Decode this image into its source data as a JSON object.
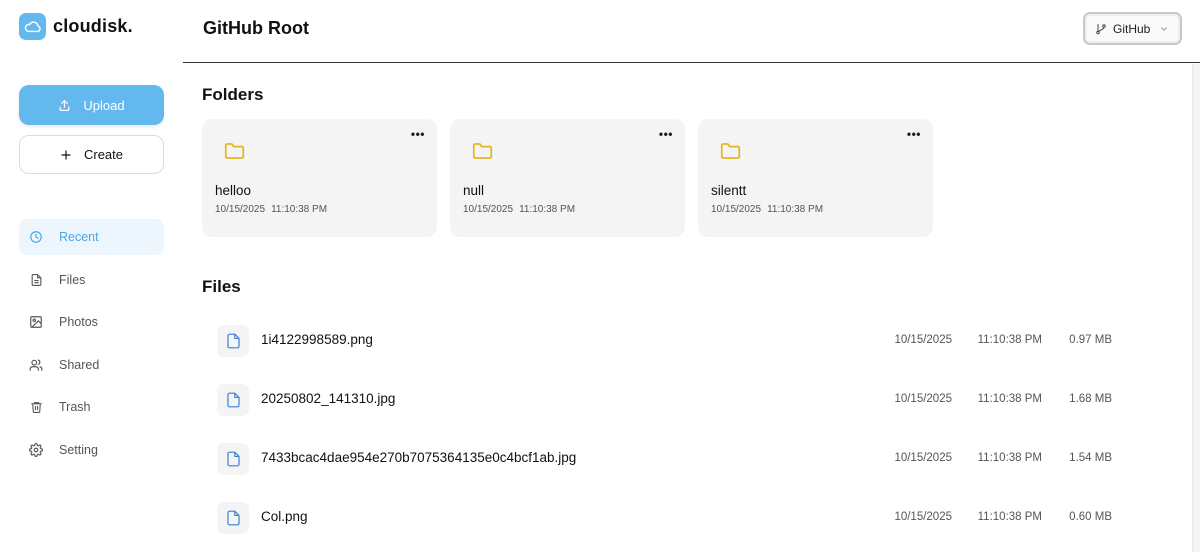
{
  "brand": {
    "name": "cloudisk."
  },
  "sidebar": {
    "upload_label": "Upload",
    "create_label": "Create",
    "items": [
      {
        "label": "Recent",
        "icon": "clock-icon"
      },
      {
        "label": "Files",
        "icon": "file-icon"
      },
      {
        "label": "Photos",
        "icon": "image-icon"
      },
      {
        "label": "Shared",
        "icon": "users-icon"
      },
      {
        "label": "Trash",
        "icon": "trash-icon"
      },
      {
        "label": "Setting",
        "icon": "gear-icon"
      }
    ],
    "active_item": "Recent"
  },
  "header": {
    "title": "GitHub Root",
    "source_select": {
      "value": "GitHub"
    }
  },
  "folders": {
    "title": "Folders",
    "items": [
      {
        "name": "helloo",
        "date": "10/15/2025",
        "time": "11:10:38 PM"
      },
      {
        "name": "null",
        "date": "10/15/2025",
        "time": "11:10:38 PM"
      },
      {
        "name": "silentt",
        "date": "10/15/2025",
        "time": "11:10:38 PM"
      }
    ]
  },
  "files": {
    "title": "Files",
    "items": [
      {
        "name": "1i4122998589.png",
        "date": "10/15/2025",
        "time": "11:10:38 PM",
        "size": "0.97 MB"
      },
      {
        "name": "20250802_141310.jpg",
        "date": "10/15/2025",
        "time": "11:10:38 PM",
        "size": "1.68 MB"
      },
      {
        "name": "7433bcac4dae954e270b7075364135e0c4bcf1ab.jpg",
        "date": "10/15/2025",
        "time": "11:10:38 PM",
        "size": "1.54 MB"
      },
      {
        "name": "Col.png",
        "date": "10/15/2025",
        "time": "11:10:38 PM",
        "size": "0.60 MB"
      }
    ]
  },
  "colors": {
    "accent": "#63b8ee",
    "active_bg": "#edf6fd",
    "folder_icon": "#e6b422",
    "file_icon": "#3b7ed8"
  }
}
